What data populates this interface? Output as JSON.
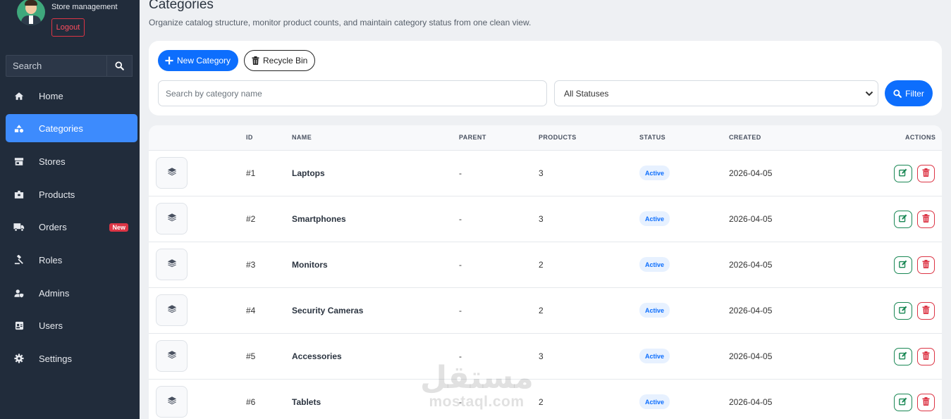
{
  "sidebar": {
    "store_label": "Store management",
    "logout_label": "Logout",
    "search_placeholder": "Search",
    "items": [
      {
        "label": "Home",
        "icon": "home-icon"
      },
      {
        "label": "Categories",
        "icon": "shapes-icon",
        "active": true
      },
      {
        "label": "Stores",
        "icon": "store-icon"
      },
      {
        "label": "Products",
        "icon": "box-icon"
      },
      {
        "label": "Orders",
        "icon": "truck-icon",
        "badge": "New"
      },
      {
        "label": "Roles",
        "icon": "gavel-icon"
      },
      {
        "label": "Admins",
        "icon": "user-shield-icon"
      },
      {
        "label": "Users",
        "icon": "id-card-icon"
      },
      {
        "label": "Settings",
        "icon": "gear-icon"
      }
    ]
  },
  "header": {
    "title": "Categories",
    "subtitle": "Organize catalog structure, monitor product counts, and maintain category status from one clean view."
  },
  "toolbar": {
    "new_label": "New Category",
    "recycle_label": "Recycle Bin",
    "search_placeholder": "Search by category name",
    "status_value": "All Statuses",
    "filter_label": "Filter"
  },
  "table": {
    "columns": [
      "ID",
      "NAME",
      "PARENT",
      "PRODUCTS",
      "STATUS",
      "CREATED",
      "ACTIONS"
    ],
    "rows": [
      {
        "id": "#1",
        "name": "Laptops",
        "parent": "-",
        "products": "3",
        "status": "Active",
        "created": "2026-04-05"
      },
      {
        "id": "#2",
        "name": "Smartphones",
        "parent": "-",
        "products": "3",
        "status": "Active",
        "created": "2026-04-05"
      },
      {
        "id": "#3",
        "name": "Monitors",
        "parent": "-",
        "products": "2",
        "status": "Active",
        "created": "2026-04-05"
      },
      {
        "id": "#4",
        "name": "Security Cameras",
        "parent": "-",
        "products": "2",
        "status": "Active",
        "created": "2026-04-05"
      },
      {
        "id": "#5",
        "name": "Accessories",
        "parent": "-",
        "products": "3",
        "status": "Active",
        "created": "2026-04-05"
      },
      {
        "id": "#6",
        "name": "Tablets",
        "parent": "-",
        "products": "2",
        "status": "Active",
        "created": "2026-04-05"
      }
    ]
  },
  "watermark": {
    "arabic": "مستقل",
    "url": "mostaql.com"
  },
  "colors": {
    "sidebar_bg": "#212c3b",
    "accent": "#0d6efd",
    "active_nav": "#3d8bfd",
    "danger": "#dc3545",
    "success": "#198754"
  }
}
